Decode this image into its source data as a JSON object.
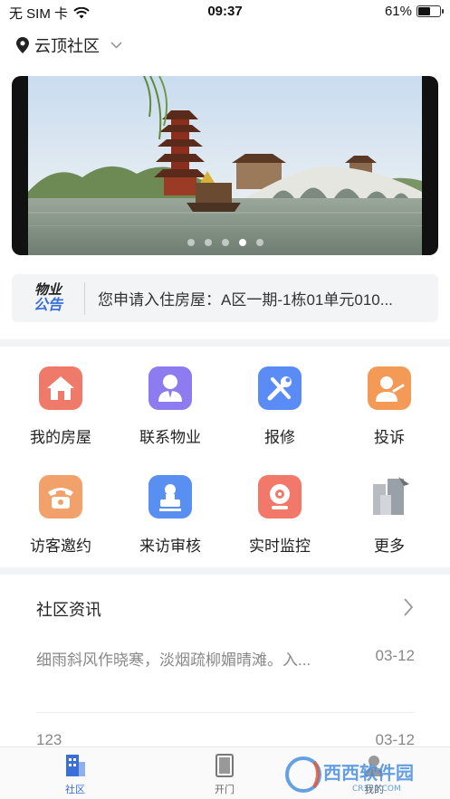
{
  "status_bar": {
    "carrier": "无 SIM 卡",
    "time": "09:37",
    "battery": "61%",
    "battery_level": 0.61
  },
  "location": {
    "name": "云顶社区"
  },
  "banner": {
    "slide_count": 5,
    "active_slide": 4
  },
  "notice": {
    "logo_line1": "物业",
    "logo_line2": "公告",
    "text": "您申请入住房屋：A区一期-1栋01单元010..."
  },
  "features": [
    {
      "label": "我的房屋",
      "icon": "house-icon",
      "color": "#f07a6a"
    },
    {
      "label": "联系物业",
      "icon": "contact-icon",
      "color": "#8d7cf0"
    },
    {
      "label": "报修",
      "icon": "repair-tools-icon",
      "color": "#5b8cf5"
    },
    {
      "label": "投诉",
      "icon": "complaint-person-icon",
      "color": "#f39a57"
    },
    {
      "label": "访客邀约",
      "icon": "telephone-icon",
      "color": "#f3a16b"
    },
    {
      "label": "来访审核",
      "icon": "visitor-review-icon",
      "color": "#5a8ff2"
    },
    {
      "label": "实时监控",
      "icon": "camera-icon",
      "color": "#f2796a"
    },
    {
      "label": "更多",
      "icon": "more-icon",
      "color": "#9aa0a8"
    }
  ],
  "news": {
    "title": "社区资讯",
    "items": [
      {
        "title": "细雨斜风作晓寒，淡烟疏柳媚晴滩。入...",
        "date": "03-12"
      },
      {
        "title": "123",
        "date": "03-12"
      }
    ]
  },
  "tabbar": {
    "tabs": [
      {
        "label": "社区",
        "active": true
      },
      {
        "label": "开门",
        "active": false
      },
      {
        "label": "我的",
        "active": false
      }
    ]
  },
  "watermark": {
    "brand": "西西软件园",
    "site": "CR173.COM"
  },
  "colors": {
    "accent": "#3a6fd8",
    "background": "#ffffff",
    "section_gap": "#f2f3f5"
  }
}
